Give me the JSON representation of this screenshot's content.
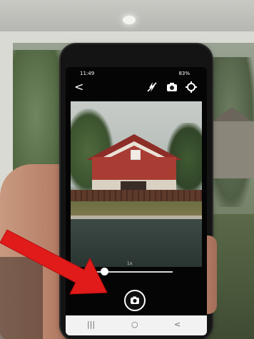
{
  "status_bar": {
    "time": "11:49",
    "notification_icons": [
      "icon-set"
    ],
    "signal_battery": "83%"
  },
  "camera_app": {
    "back_glyph": "<",
    "top_icons": [
      "flash-off-icon",
      "camera-switch-icon",
      "settings-gear-icon"
    ],
    "zoom_label": "1x",
    "zoom_level": 0.1,
    "shutter_icon": "camera-icon"
  },
  "nav_bar": {
    "items": [
      "|||",
      "○",
      "<"
    ]
  },
  "annotation": {
    "arrow_color": "#e11a1a"
  }
}
